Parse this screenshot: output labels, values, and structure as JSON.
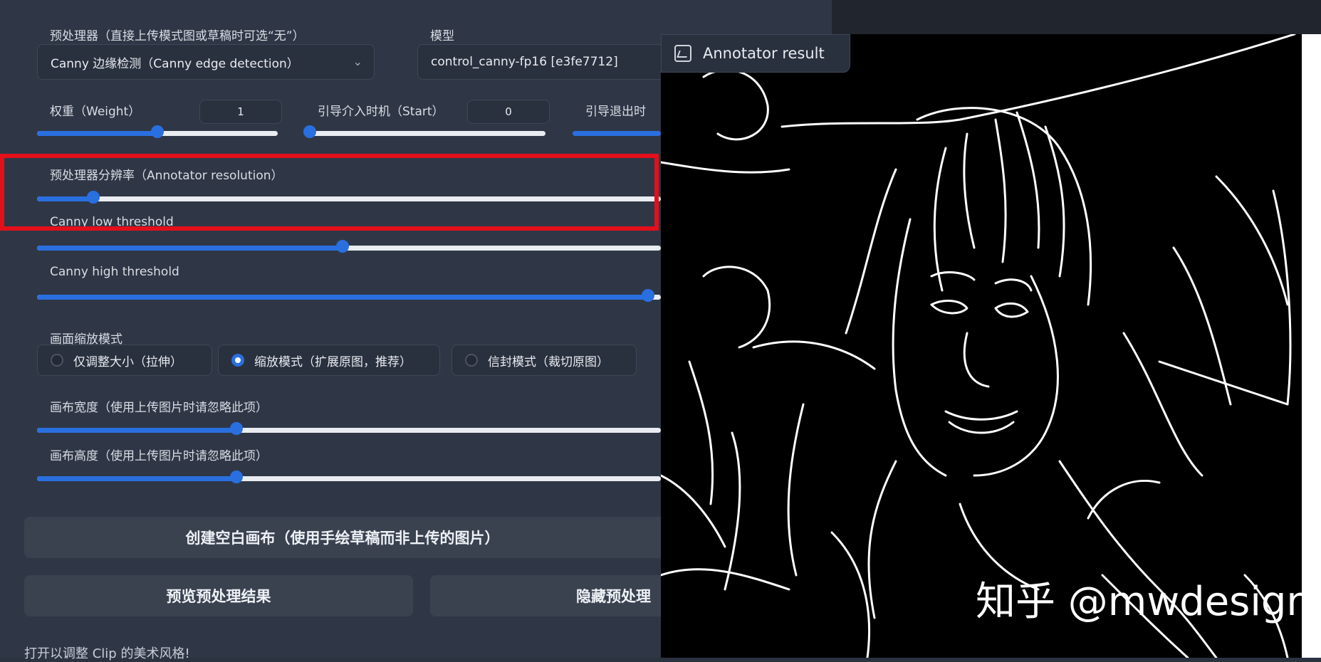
{
  "preprocessor": {
    "label": "预处理器（直接上传模式图或草稿时可选“无”）",
    "value": "Canny 边缘检测（Canny edge detection）"
  },
  "model": {
    "label": "模型",
    "value": "control_canny-fp16 [e3fe7712]"
  },
  "weight": {
    "label": "权重（Weight）",
    "value": "1",
    "level": 0.5
  },
  "start": {
    "label": "引导介入时机（Start）",
    "value": "0",
    "level": 0.0
  },
  "end": {
    "label": "引导退出时",
    "level": 1.0
  },
  "annotator_resolution": {
    "label": "预处理器分辨率（Annotator resolution）",
    "level": 0.09
  },
  "canny_low": {
    "label": "Canny low threshold",
    "level": 0.49
  },
  "canny_high": {
    "label": "Canny high threshold",
    "level": 0.98
  },
  "resize_mode": {
    "label": "画面缩放模式",
    "options": [
      "仅调整大小（拉伸）",
      "缩放模式（扩展原图，推荐）",
      "信封模式（裁切原图）"
    ],
    "selected": "缩放模式（扩展原图，推荐）"
  },
  "canvas_width": {
    "label": "画布宽度（使用上传图片时请忽略此项）",
    "level": 0.39
  },
  "canvas_height": {
    "label": "画布高度（使用上传图片时请忽略此项）",
    "level": 0.39
  },
  "buttons": {
    "create_canvas": "创建空白画布（使用手绘草稿而非上传的图片）",
    "preview": "预览预处理结果",
    "hide": "隐藏预处理"
  },
  "footer_text": "打开以调整 Clip 的美术风格!",
  "result_tab": "Annotator result",
  "watermark": "知乎 @mwdesign",
  "colors": {
    "accent": "#2a6fdf",
    "highlight": "#e3101a",
    "panel": "#2f3746"
  }
}
